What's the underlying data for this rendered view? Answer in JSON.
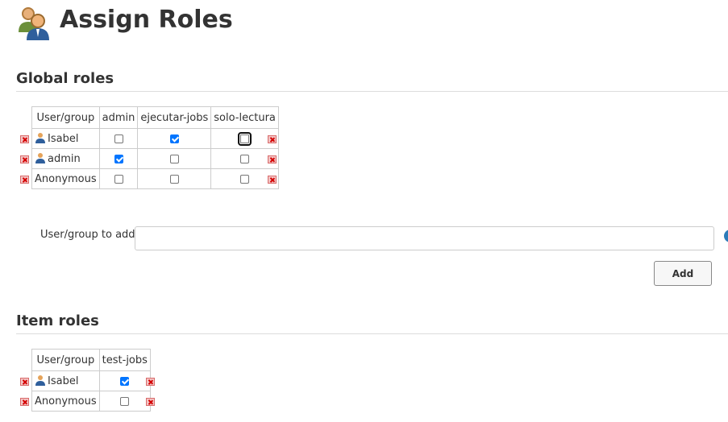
{
  "page": {
    "title": "Assign Roles"
  },
  "global_roles": {
    "heading": "Global roles",
    "columns": [
      "User/group",
      "admin",
      "ejecutar-jobs",
      "solo-lectura"
    ],
    "rows": [
      {
        "name": "Isabel",
        "icon": "user-icon",
        "checks": [
          false,
          true,
          false
        ]
      },
      {
        "name": "admin",
        "icon": "user-icon",
        "checks": [
          true,
          false,
          false
        ]
      },
      {
        "name": "Anonymous",
        "icon": null,
        "checks": [
          false,
          false,
          false
        ]
      }
    ]
  },
  "add_user": {
    "label": "User/group to add",
    "value": "",
    "placeholder": "",
    "button_label": "Add"
  },
  "item_roles": {
    "heading": "Item roles",
    "columns": [
      "User/group",
      "test-jobs"
    ],
    "rows": [
      {
        "name": "Isabel",
        "icon": "user-icon",
        "checks": [
          true
        ]
      },
      {
        "name": "Anonymous",
        "icon": null,
        "checks": [
          false
        ]
      }
    ]
  },
  "colors": {
    "checkbox_checked": "#0075ff",
    "delete_icon": "#d40000"
  }
}
